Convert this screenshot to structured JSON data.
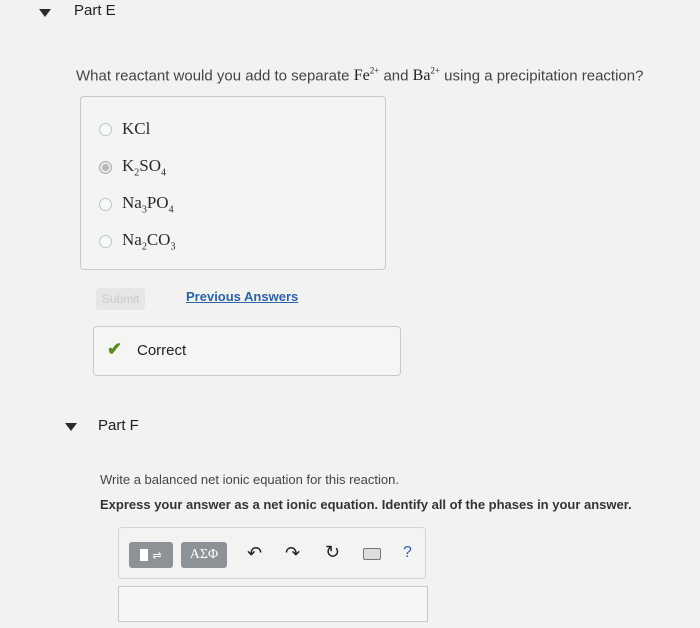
{
  "partE": {
    "title": "Part E",
    "question_prefix": "What reactant would you add to separate",
    "question_and": "and",
    "question_suffix": "using a precipitation reaction?",
    "ion1": {
      "symbol": "Fe",
      "charge": "2+"
    },
    "ion2": {
      "symbol": "Ba",
      "charge": "2+"
    },
    "choices": [
      {
        "parts": [
          {
            "t": "KCl"
          }
        ],
        "selected": false
      },
      {
        "parts": [
          {
            "t": "K"
          },
          {
            "s": "2"
          },
          {
            "t": "SO"
          },
          {
            "s": "4"
          }
        ],
        "selected": true
      },
      {
        "parts": [
          {
            "t": "Na"
          },
          {
            "s": "3"
          },
          {
            "t": "PO"
          },
          {
            "s": "4"
          }
        ],
        "selected": false
      },
      {
        "parts": [
          {
            "t": "Na"
          },
          {
            "s": "2"
          },
          {
            "t": "CO"
          },
          {
            "s": "3"
          }
        ],
        "selected": false
      }
    ],
    "submit_label": "Submit",
    "previous_answers_label": "Previous Answers",
    "feedback_label": "Correct"
  },
  "partF": {
    "title": "Part F",
    "instruction": "Write a balanced net ionic equation for this reaction.",
    "instruction_bold": "Express your answer as a net ionic equation. Identify all of the phases in your answer.",
    "toolbar": {
      "greek_label": "ΑΣΦ",
      "help_label": "?"
    },
    "answer_value": ""
  },
  "colors": {
    "link": "#2b62a8",
    "check": "#5a8a18"
  }
}
